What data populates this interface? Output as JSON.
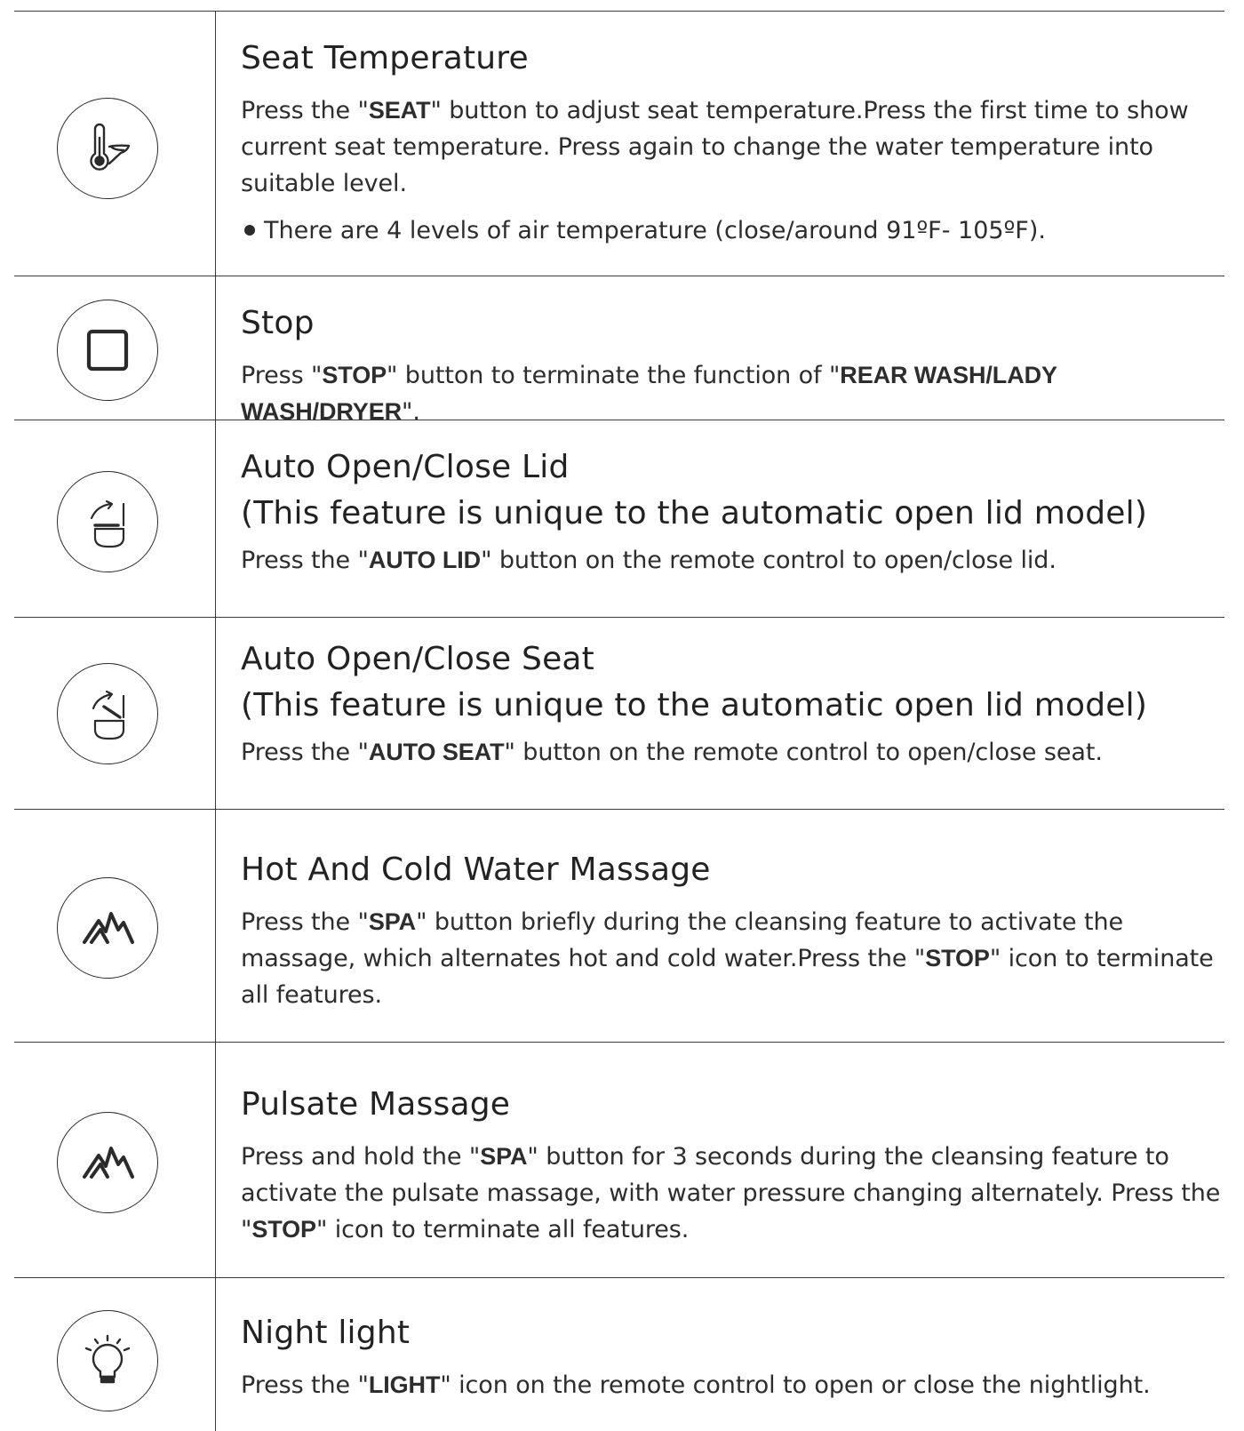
{
  "rows": [
    {
      "icon": "seat-temperature-icon",
      "title": "Seat Temperature",
      "desc": [
        {
          "t": "Press the \"",
          "b": false
        },
        {
          "t": "SEAT",
          "b": true
        },
        {
          "t": "\" button to adjust seat temperature.Press the first time to show current seat temperature. Press again to change the water temperature into suitable level.",
          "b": false
        }
      ],
      "note": "There are 4 levels of air temperature (close/around 91ºF- 105ºF)."
    },
    {
      "icon": "stop-icon",
      "title": "Stop",
      "desc": [
        {
          "t": "Press \"",
          "b": false
        },
        {
          "t": "STOP",
          "b": true
        },
        {
          "t": "\" button to terminate the function of \"",
          "b": false
        },
        {
          "t": "REAR WASH/LADY WASH/DRYER",
          "b": true
        },
        {
          "t": "\".",
          "b": false
        }
      ]
    },
    {
      "icon": "auto-lid-icon",
      "title": "Auto Open/Close Lid",
      "subtitle": "(This feature is unique to the automatic open lid model)",
      "desc": [
        {
          "t": "Press the \"",
          "b": false
        },
        {
          "t": "AUTO LID",
          "b": true
        },
        {
          "t": "\" button on the remote control to open/close lid.",
          "b": false
        }
      ]
    },
    {
      "icon": "auto-seat-icon",
      "title": "Auto Open/Close Seat",
      "subtitle": "(This feature is unique to the automatic open lid model)",
      "desc": [
        {
          "t": "Press the \"",
          "b": false
        },
        {
          "t": "AUTO SEAT",
          "b": true
        },
        {
          "t": "\" button on the remote control to open/close seat.",
          "b": false
        }
      ]
    },
    {
      "icon": "spa-massage-icon",
      "title": "Hot And Cold Water Massage",
      "desc": [
        {
          "t": "Press the \"",
          "b": false
        },
        {
          "t": "SPA",
          "b": true
        },
        {
          "t": "\" button briefly during the cleansing feature to activate the massage, which alternates hot and cold water.Press the \"",
          "b": false
        },
        {
          "t": "STOP",
          "b": true
        },
        {
          "t": "\" icon to terminate all features.",
          "b": false
        }
      ]
    },
    {
      "icon": "spa-pulsate-icon",
      "title": "Pulsate Massage",
      "desc": [
        {
          "t": "Press and hold the \"",
          "b": false
        },
        {
          "t": "SPA",
          "b": true
        },
        {
          "t": "\" button for 3 seconds during the cleansing feature to activate the pulsate massage, with water pressure changing alternately. Press the \"",
          "b": false
        },
        {
          "t": "STOP",
          "b": true
        },
        {
          "t": "\" icon to terminate all features.",
          "b": false
        }
      ]
    },
    {
      "icon": "night-light-icon",
      "title": "Night light",
      "desc": [
        {
          "t": "Press the \"",
          "b": false
        },
        {
          "t": "LIGHT",
          "b": true
        },
        {
          "t": "\" icon on the remote control to open or close the nightlight.",
          "b": false
        }
      ]
    }
  ]
}
